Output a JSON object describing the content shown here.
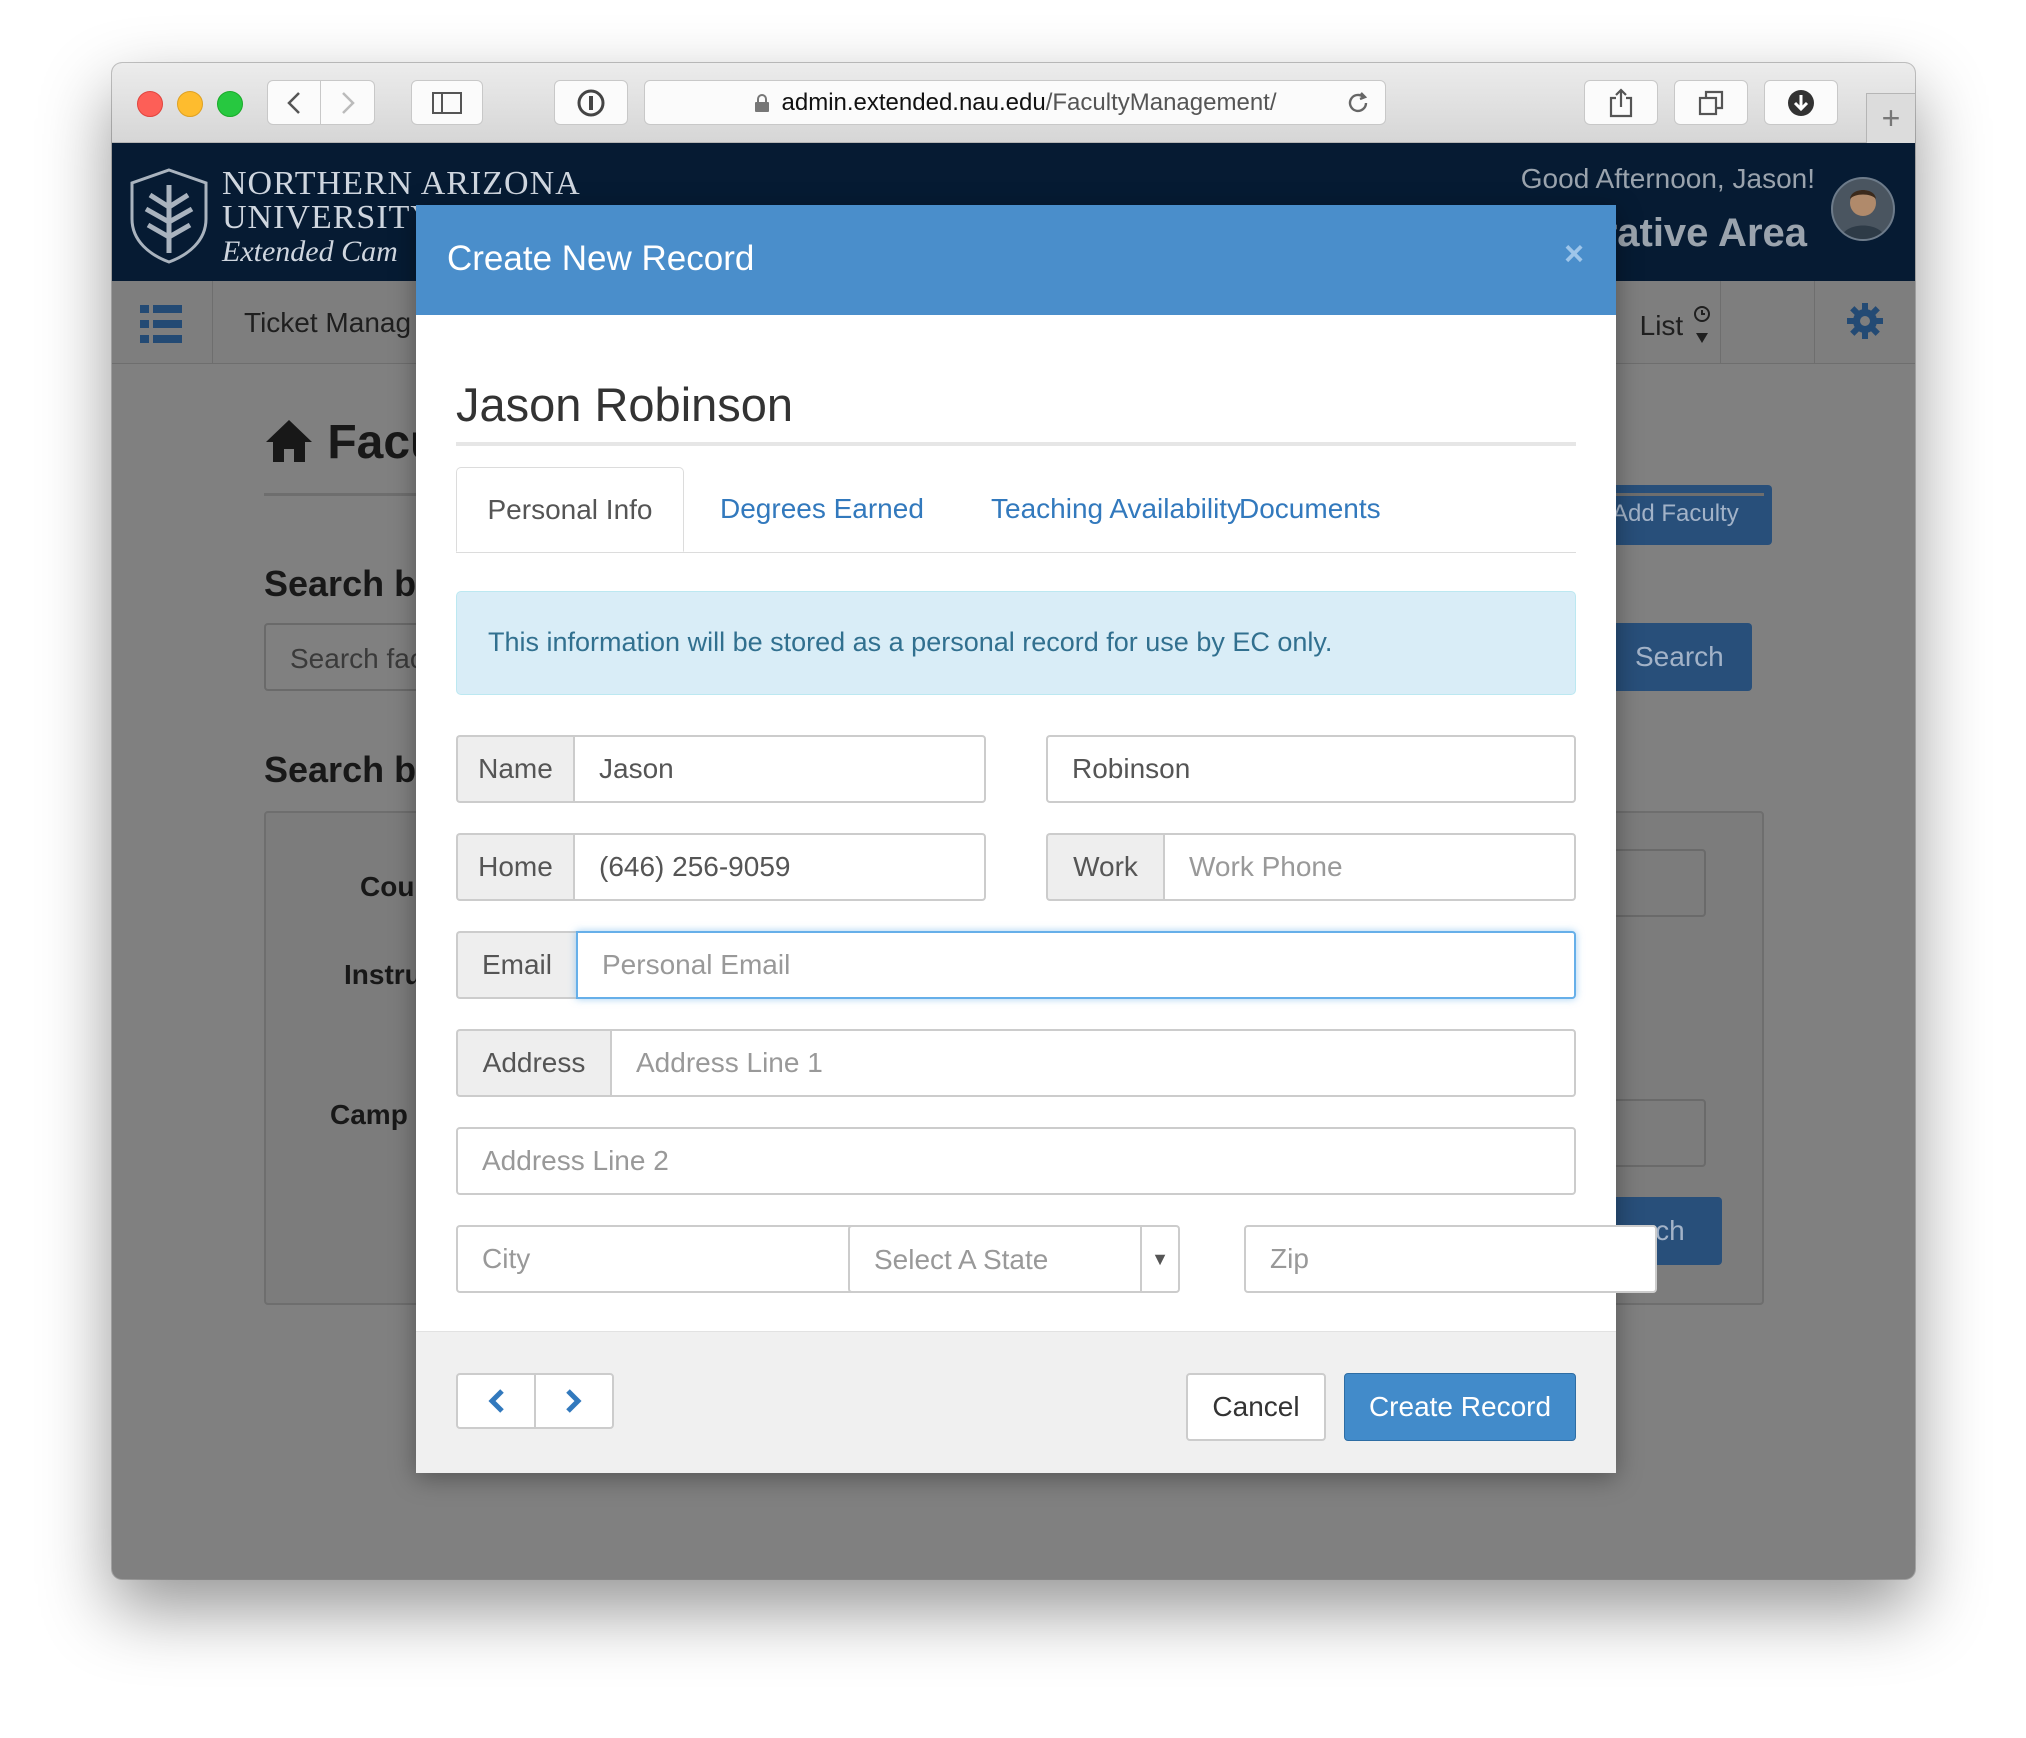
{
  "browser": {
    "url_host": "admin.extended.nau.edu",
    "url_path": "/FacultyManagement/"
  },
  "site": {
    "logo_line1": "NORTHERN ARIZONA",
    "logo_line2": "UNIVERSITY",
    "logo_line3": "Extended Cam",
    "greeting": "Good Afternoon, Jason!",
    "area_title": "rative Area",
    "nav_ticket": "Ticket Manag",
    "nav_list": "List",
    "page_title": "Facu",
    "add_faculty": "Add Faculty",
    "search_by_1": "Search b",
    "search_placeholder": "Search fac",
    "search_button": "Search",
    "search_by_2": "Search b",
    "label_course": "Cou",
    "label_instructor": "Instru",
    "label_campus": "Camp",
    "search_button_2": "Search"
  },
  "modal": {
    "title": "Create New Record",
    "close": "×",
    "person_name": "Jason Robinson",
    "tabs": [
      {
        "label": "Personal Info",
        "active": true
      },
      {
        "label": "Degrees Earned",
        "active": false
      },
      {
        "label": "Teaching Availability",
        "active": false
      },
      {
        "label": "Documents",
        "active": false
      }
    ],
    "info_text": "This information will be stored as a personal record for use by EC only.",
    "form": {
      "name_label": "Name",
      "first_name": "Jason",
      "last_name": "Robinson",
      "home_label": "Home",
      "home_phone": "(646) 256-9059",
      "work_label": "Work",
      "work_phone_placeholder": "Work Phone",
      "email_label": "Email",
      "email_placeholder": "Personal Email",
      "address_label": "Address",
      "address1_placeholder": "Address Line 1",
      "address2_placeholder": "Address Line 2",
      "city_placeholder": "City",
      "state_selected": "Select A State",
      "zip_placeholder": "Zip"
    },
    "footer": {
      "cancel": "Cancel",
      "create": "Create Record"
    }
  },
  "colors": {
    "modal_header": "#4a8ecb",
    "primary_button": "#428bca",
    "tab_link": "#3279bd",
    "alert_bg": "#d9edf7",
    "alert_text": "#31708f",
    "site_header": "#061b33"
  },
  "icons": [
    "back-icon",
    "forward-icon",
    "sidebar-icon",
    "password-icon",
    "lock-icon",
    "reload-icon",
    "share-icon",
    "tabs-icon",
    "download-icon",
    "plus-icon",
    "list-icon",
    "clock-icon",
    "gear-icon",
    "home-icon",
    "chevron-left-icon",
    "chevron-right-icon"
  ]
}
